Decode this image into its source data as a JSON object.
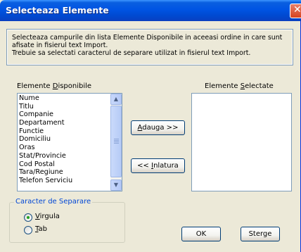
{
  "window": {
    "title": "Selecteaza Elemente",
    "close_glyph": "✕"
  },
  "info": {
    "line1": "Selecteaza campurile din lista Elemente Disponibile in aceeasi ordine in care sunt",
    "line2": "afisate in fisierul text Import.",
    "line3": "Trebuie sa selectati caracterul de separare utilizat in fisierul text Import."
  },
  "available": {
    "label_pre": "Elemente ",
    "label_accel": "D",
    "label_post": "isponibile",
    "items": [
      "Nume",
      "Titlu",
      "Companie",
      "Departament",
      "Functie",
      "Domiciliu",
      "Oras",
      "Stat/Provincie",
      "Cod Postal",
      "Tara/Regiune",
      "Telefon Serviciu"
    ]
  },
  "selected": {
    "label_pre": "Elemente ",
    "label_accel": "S",
    "label_post": "electate",
    "items": []
  },
  "buttons": {
    "add_accel": "A",
    "add_rest": "dauga >>",
    "remove_pre": "<< ",
    "remove_accel": "I",
    "remove_post": "nlatura",
    "ok": "OK",
    "clear": "Sterge"
  },
  "separator": {
    "title": "Caracter de Separare",
    "options": [
      {
        "accel": "V",
        "rest": "irgula",
        "selected": true
      },
      {
        "accel": "T",
        "rest": "ab",
        "selected": false
      }
    ]
  },
  "colors": {
    "titlebar": "#0054e3",
    "group_title": "#0046d5",
    "dialog_bg": "#ece9d8"
  }
}
